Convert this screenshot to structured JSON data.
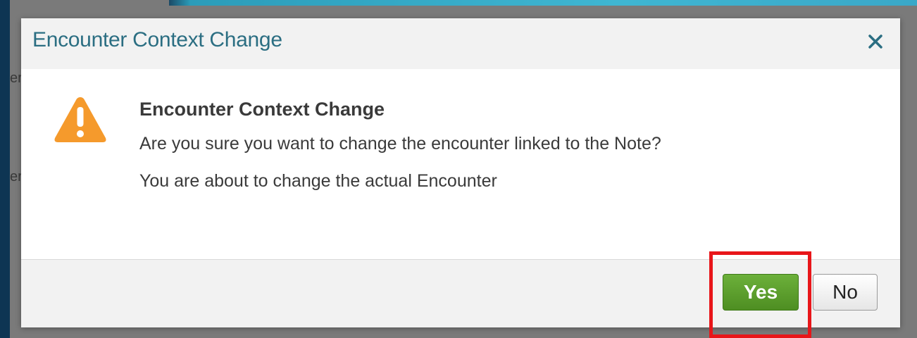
{
  "background": {
    "fragments": [
      "er",
      "er"
    ]
  },
  "dialog": {
    "title": "Encounter Context Change",
    "close_icon": "close-icon",
    "warning_icon": "warning-triangle-icon",
    "message_title": "Encounter Context Change",
    "message_line_1": "Are you sure you want to change the encounter linked to the Note?",
    "message_line_2": "You are about to change the actual Encounter",
    "yes_label": "Yes",
    "no_label": "No"
  },
  "colors": {
    "title_text": "#2b6e82",
    "warning_orange": "#f59a2c",
    "yes_green": "#5a9e2c",
    "highlight_red": "#e8161a"
  }
}
